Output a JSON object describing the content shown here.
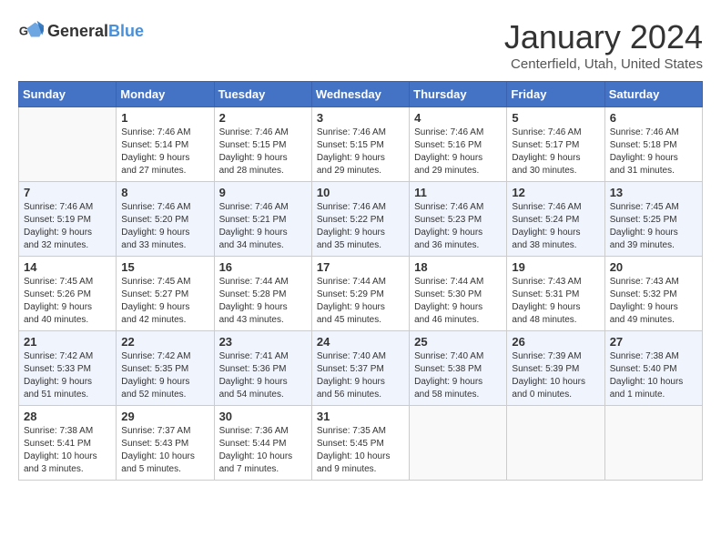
{
  "logo": {
    "general": "General",
    "blue": "Blue"
  },
  "title": "January 2024",
  "location": "Centerfield, Utah, United States",
  "weekdays": [
    "Sunday",
    "Monday",
    "Tuesday",
    "Wednesday",
    "Thursday",
    "Friday",
    "Saturday"
  ],
  "weeks": [
    [
      {
        "day": "",
        "info": ""
      },
      {
        "day": "1",
        "info": "Sunrise: 7:46 AM\nSunset: 5:14 PM\nDaylight: 9 hours\nand 27 minutes."
      },
      {
        "day": "2",
        "info": "Sunrise: 7:46 AM\nSunset: 5:15 PM\nDaylight: 9 hours\nand 28 minutes."
      },
      {
        "day": "3",
        "info": "Sunrise: 7:46 AM\nSunset: 5:15 PM\nDaylight: 9 hours\nand 29 minutes."
      },
      {
        "day": "4",
        "info": "Sunrise: 7:46 AM\nSunset: 5:16 PM\nDaylight: 9 hours\nand 29 minutes."
      },
      {
        "day": "5",
        "info": "Sunrise: 7:46 AM\nSunset: 5:17 PM\nDaylight: 9 hours\nand 30 minutes."
      },
      {
        "day": "6",
        "info": "Sunrise: 7:46 AM\nSunset: 5:18 PM\nDaylight: 9 hours\nand 31 minutes."
      }
    ],
    [
      {
        "day": "7",
        "info": "Sunrise: 7:46 AM\nSunset: 5:19 PM\nDaylight: 9 hours\nand 32 minutes."
      },
      {
        "day": "8",
        "info": "Sunrise: 7:46 AM\nSunset: 5:20 PM\nDaylight: 9 hours\nand 33 minutes."
      },
      {
        "day": "9",
        "info": "Sunrise: 7:46 AM\nSunset: 5:21 PM\nDaylight: 9 hours\nand 34 minutes."
      },
      {
        "day": "10",
        "info": "Sunrise: 7:46 AM\nSunset: 5:22 PM\nDaylight: 9 hours\nand 35 minutes."
      },
      {
        "day": "11",
        "info": "Sunrise: 7:46 AM\nSunset: 5:23 PM\nDaylight: 9 hours\nand 36 minutes."
      },
      {
        "day": "12",
        "info": "Sunrise: 7:46 AM\nSunset: 5:24 PM\nDaylight: 9 hours\nand 38 minutes."
      },
      {
        "day": "13",
        "info": "Sunrise: 7:45 AM\nSunset: 5:25 PM\nDaylight: 9 hours\nand 39 minutes."
      }
    ],
    [
      {
        "day": "14",
        "info": "Sunrise: 7:45 AM\nSunset: 5:26 PM\nDaylight: 9 hours\nand 40 minutes."
      },
      {
        "day": "15",
        "info": "Sunrise: 7:45 AM\nSunset: 5:27 PM\nDaylight: 9 hours\nand 42 minutes."
      },
      {
        "day": "16",
        "info": "Sunrise: 7:44 AM\nSunset: 5:28 PM\nDaylight: 9 hours\nand 43 minutes."
      },
      {
        "day": "17",
        "info": "Sunrise: 7:44 AM\nSunset: 5:29 PM\nDaylight: 9 hours\nand 45 minutes."
      },
      {
        "day": "18",
        "info": "Sunrise: 7:44 AM\nSunset: 5:30 PM\nDaylight: 9 hours\nand 46 minutes."
      },
      {
        "day": "19",
        "info": "Sunrise: 7:43 AM\nSunset: 5:31 PM\nDaylight: 9 hours\nand 48 minutes."
      },
      {
        "day": "20",
        "info": "Sunrise: 7:43 AM\nSunset: 5:32 PM\nDaylight: 9 hours\nand 49 minutes."
      }
    ],
    [
      {
        "day": "21",
        "info": "Sunrise: 7:42 AM\nSunset: 5:33 PM\nDaylight: 9 hours\nand 51 minutes."
      },
      {
        "day": "22",
        "info": "Sunrise: 7:42 AM\nSunset: 5:35 PM\nDaylight: 9 hours\nand 52 minutes."
      },
      {
        "day": "23",
        "info": "Sunrise: 7:41 AM\nSunset: 5:36 PM\nDaylight: 9 hours\nand 54 minutes."
      },
      {
        "day": "24",
        "info": "Sunrise: 7:40 AM\nSunset: 5:37 PM\nDaylight: 9 hours\nand 56 minutes."
      },
      {
        "day": "25",
        "info": "Sunrise: 7:40 AM\nSunset: 5:38 PM\nDaylight: 9 hours\nand 58 minutes."
      },
      {
        "day": "26",
        "info": "Sunrise: 7:39 AM\nSunset: 5:39 PM\nDaylight: 10 hours\nand 0 minutes."
      },
      {
        "day": "27",
        "info": "Sunrise: 7:38 AM\nSunset: 5:40 PM\nDaylight: 10 hours\nand 1 minute."
      }
    ],
    [
      {
        "day": "28",
        "info": "Sunrise: 7:38 AM\nSunset: 5:41 PM\nDaylight: 10 hours\nand 3 minutes."
      },
      {
        "day": "29",
        "info": "Sunrise: 7:37 AM\nSunset: 5:43 PM\nDaylight: 10 hours\nand 5 minutes."
      },
      {
        "day": "30",
        "info": "Sunrise: 7:36 AM\nSunset: 5:44 PM\nDaylight: 10 hours\nand 7 minutes."
      },
      {
        "day": "31",
        "info": "Sunrise: 7:35 AM\nSunset: 5:45 PM\nDaylight: 10 hours\nand 9 minutes."
      },
      {
        "day": "",
        "info": ""
      },
      {
        "day": "",
        "info": ""
      },
      {
        "day": "",
        "info": ""
      }
    ]
  ]
}
